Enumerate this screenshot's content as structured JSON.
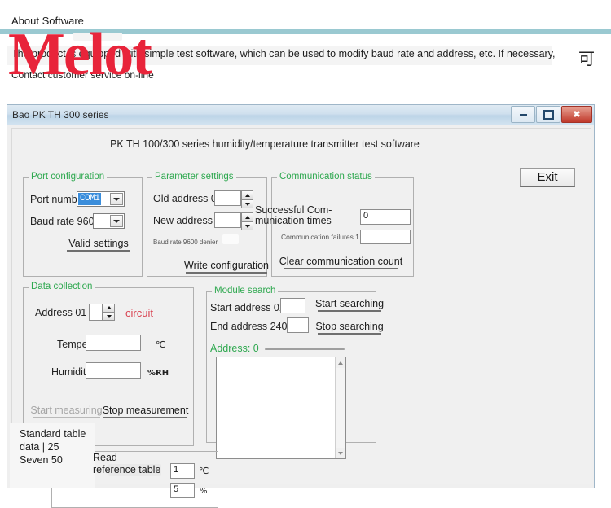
{
  "page": {
    "about_title": "About Software",
    "description": "The product is equipped with simple test software, which can be used to modify baud rate and address, etc. If necessary,",
    "contact": "Contact customer service on-line",
    "cjk_glyph": "可",
    "watermark": "Melot",
    "watermark_color": "#e8243a",
    "rule_color": "#9ac9d1"
  },
  "window": {
    "title": "Bao PK TH 300 series",
    "minimize_label": "–",
    "maximize_label": "□",
    "close_label": "✕",
    "heading": "PK TH 100/300 series humidity/temperature transmitter test software",
    "exit_label": "Exit"
  },
  "port_configuration": {
    "title": "Port configuration",
    "port_number_label": "Port number",
    "port_number_value": "COM1",
    "baud_rate_label": "Baud rate 9600",
    "baud_rate_value": "",
    "valid_settings_label": "Valid settings"
  },
  "parameter_settings": {
    "title": "Parameter settings",
    "old_address_label": "Old address 01",
    "old_address_value": "",
    "new_address_label": "New address 01",
    "new_address_value": "",
    "denier_label": "Baud rate 9600 denier",
    "write_configuration_label": "Write configuration"
  },
  "communication_status": {
    "title": "Communication status",
    "success_label": "Successful Com-munication times",
    "success_value": "0",
    "failures_label": "Communication failures 1",
    "failures_value": "",
    "clear_label": "Clear communication count"
  },
  "data_collection": {
    "title": "Data collection",
    "address_label": "Address 01",
    "address_value": "",
    "circuit_label": "circuit",
    "temperature_label": "Temperature",
    "temperature_value": "",
    "temperature_unit": "℃",
    "humidity_label": "Humidity",
    "humidity_value": "",
    "humidity_unit": "%RH",
    "start_measuring_label": "Start measuring",
    "stop_measurement_label": "Stop measurement"
  },
  "module_search": {
    "title": "Module search",
    "start_address_label": "Start address 01",
    "start_address_value": "",
    "end_address_label": "End address 240",
    "end_address_value": "",
    "start_searching_label": "Start searching",
    "stop_searching_label": "Stop searching",
    "address_result_label": "Address: 0",
    "result_list_value": ""
  },
  "reference_table": {
    "tooltip_text": "Standard table data | 25 Seven 50",
    "read_reference_label": "Read reference table",
    "temp_value": "1",
    "temp_unit": "℃",
    "humidity_value": "5",
    "humidity_unit": "%"
  }
}
